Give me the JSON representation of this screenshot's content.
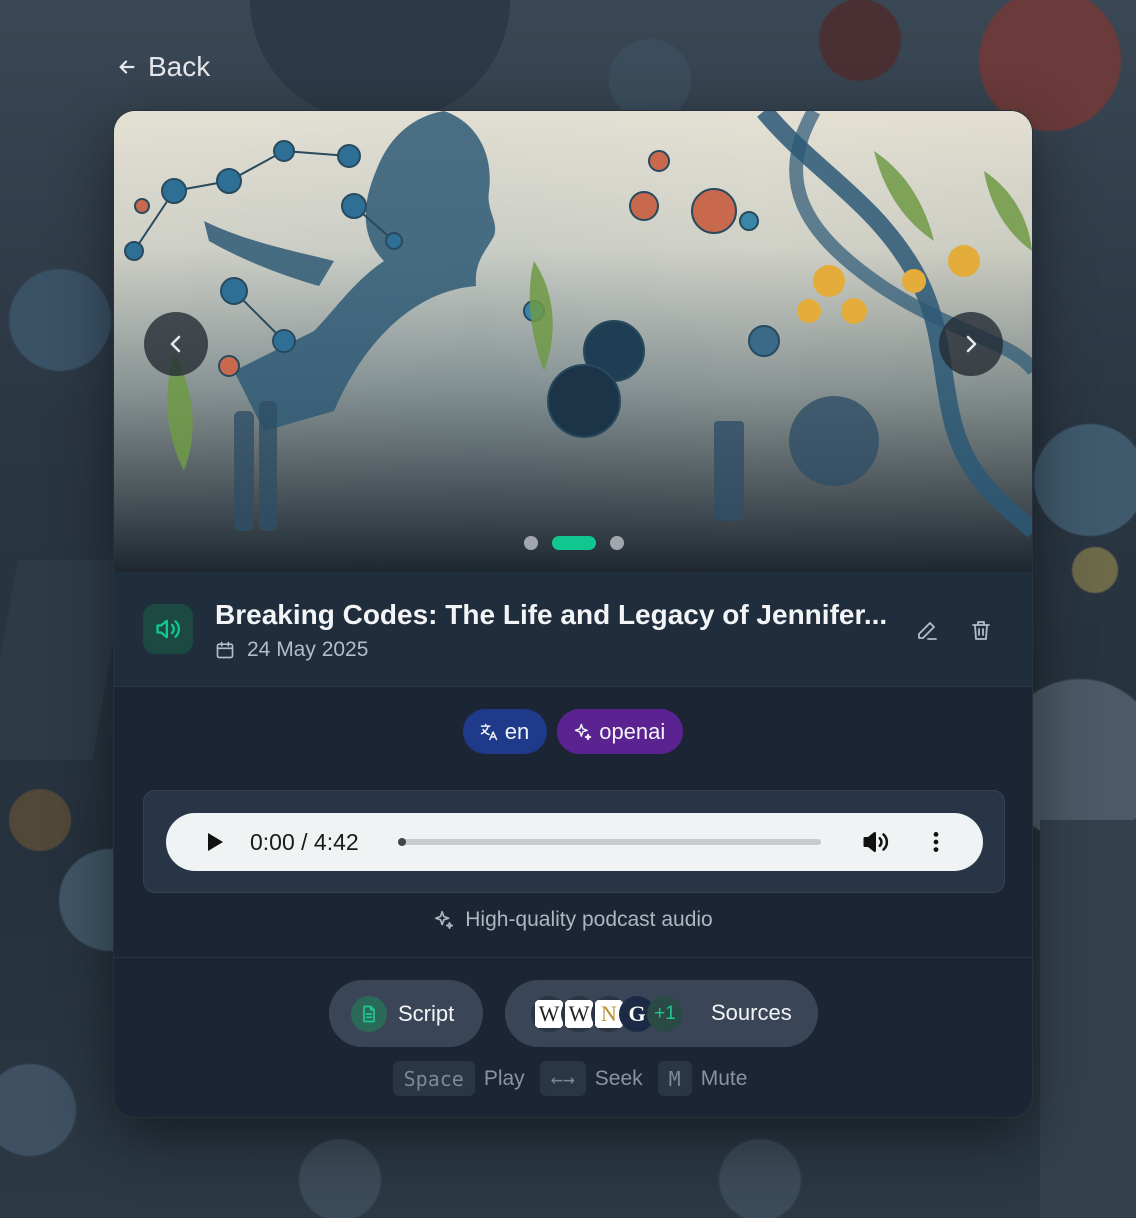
{
  "nav": {
    "back_label": "Back"
  },
  "carousel": {
    "slide_count": 3,
    "active_slide_index": 1
  },
  "episode": {
    "title": "Breaking Codes: The Life and Legacy of Jennifer...",
    "date": "24 May 2025"
  },
  "tags": {
    "language": "en",
    "provider": "openai"
  },
  "player": {
    "time_display": "0:00 / 4:42",
    "current_time": "0:00",
    "duration": "4:42",
    "progress_fraction": 0
  },
  "audio_note": "High-quality podcast audio",
  "actions": {
    "script_label": "Script",
    "sources_label": "Sources",
    "sources_favicons": [
      "W",
      "W",
      "N",
      "G"
    ],
    "sources_extra": "+1"
  },
  "shortcuts": [
    {
      "key": "Space",
      "label": "Play"
    },
    {
      "key": "←→",
      "label": "Seek"
    },
    {
      "key": "M",
      "label": "Mute"
    }
  ],
  "colors": {
    "accent": "#10c78f",
    "language_tag": "#1f3a8a",
    "provider_tag": "#5b2391",
    "card_bg": "#1c2533"
  }
}
